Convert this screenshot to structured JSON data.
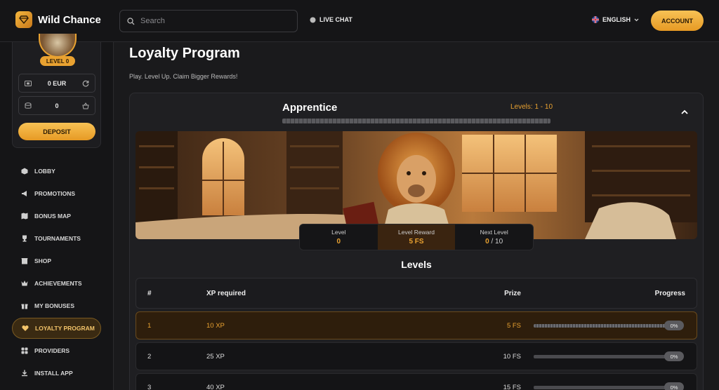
{
  "header": {
    "brand": "Wild Chance",
    "search_placeholder": "Search",
    "live_chat": "LIVE CHAT",
    "language": "ENGLISH",
    "account": "ACCOUNT"
  },
  "profile": {
    "level": "LEVEL 0",
    "balance_eur": "0 EUR",
    "coins": "0",
    "deposit": "DEPOSIT"
  },
  "sidebar": {
    "items": [
      {
        "label": "LOBBY",
        "icon": "cube-icon"
      },
      {
        "label": "PROMOTIONS",
        "icon": "megaphone-icon"
      },
      {
        "label": "BONUS MAP",
        "icon": "map-icon"
      },
      {
        "label": "TOURNAMENTS",
        "icon": "trophy-icon"
      },
      {
        "label": "SHOP",
        "icon": "shop-icon"
      },
      {
        "label": "ACHIEVEMENTS",
        "icon": "crown-icon"
      },
      {
        "label": "MY BONUSES",
        "icon": "gift-icon"
      },
      {
        "label": "LOYALTY PROGRAM",
        "icon": "heart-icon",
        "active": true
      },
      {
        "label": "PROVIDERS",
        "icon": "grid-icon"
      },
      {
        "label": "INSTALL APP",
        "icon": "download-icon"
      }
    ]
  },
  "page": {
    "title": "Loyalty Program",
    "subtitle": "Play. Level Up. Claim Bigger Rewards!"
  },
  "tier": {
    "name": "Apprentice",
    "levels_range": "Levels: 1 - 10"
  },
  "stats": {
    "level_label": "Level",
    "level_value": "0",
    "reward_label": "Level Reward",
    "reward_value": "5 FS",
    "next_label": "Next Level",
    "next_current": "0",
    "next_total": " / 10"
  },
  "levels": {
    "title": "Levels",
    "columns": {
      "num": "#",
      "xp": "XP required",
      "prize": "Prize",
      "progress": "Progress"
    },
    "rows": [
      {
        "num": "1",
        "xp": "10 XP",
        "prize": "5 FS",
        "progress": "0%",
        "progress_value": 0,
        "active": true
      },
      {
        "num": "2",
        "xp": "25 XP",
        "prize": "10 FS",
        "progress": "0%",
        "progress_value": 0
      },
      {
        "num": "3",
        "xp": "40 XP",
        "prize": "15 FS",
        "progress": "0%",
        "progress_value": 0
      }
    ]
  },
  "colors": {
    "accent": "#e9a231",
    "background": "#1a1a1c"
  }
}
